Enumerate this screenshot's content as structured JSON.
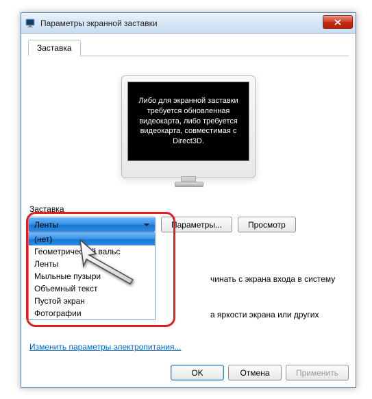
{
  "titlebar": {
    "title": "Параметры экранной заставки"
  },
  "tab": {
    "label": "Заставка"
  },
  "monitor": {
    "message": "Либо для экранной заставки требуется обновленная видеокарта, либо требуется видеокарта, совместимая с Direct3D."
  },
  "section": {
    "label": "Заставка"
  },
  "combo": {
    "selected": "Ленты",
    "options": [
      "(нет)",
      "Геометрический вальс",
      "Ленты",
      "Мыльные пузыри",
      "Объемный текст",
      "Пустой экран",
      "Фотографии"
    ]
  },
  "buttons": {
    "settings": "Параметры...",
    "preview": "Просмотр",
    "ok": "OK",
    "cancel": "Отмена",
    "apply": "Применить"
  },
  "partial": {
    "resume": "чинать с экрана входа в систему",
    "brightness": "а яркости экрана или других"
  },
  "link": {
    "power": "Изменить параметры электропитания..."
  }
}
